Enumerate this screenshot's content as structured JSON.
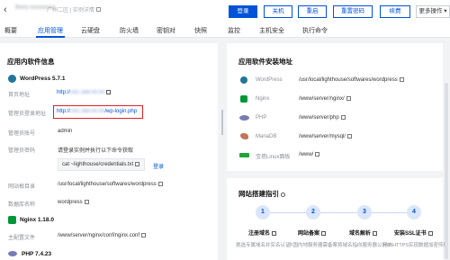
{
  "header": {
    "instance_id": "lhins-xxxxxxxx",
    "subtitle": "广州二区 | 实例详情",
    "buttons": {
      "login": "登录",
      "shutdown": "关机",
      "restart": "重启",
      "reset_password": "重置密码",
      "renew": "续费",
      "more": "更多操作"
    }
  },
  "tabs": [
    "概要",
    "应用管理",
    "云硬盘",
    "防火墙",
    "密钥对",
    "快照",
    "监控",
    "主机安全",
    "执行命令"
  ],
  "left_panel": {
    "title": "应用内软件信息",
    "wordpress": {
      "name": "WordPress 5.7.1",
      "home_label": "首页地址",
      "home_value": "http://",
      "admin_url_label": "管理员登录地址",
      "admin_url_prefix": "http://",
      "admin_url_suffix": "/wp-login.php",
      "admin_user_label": "管理员账号",
      "admin_user_value": "admin",
      "admin_pass_label": "管理员密码",
      "admin_pass_hint": "请登录实例并执行以下命令获取",
      "admin_pass_cmd": "cat ~lighthouse/credentials.txt",
      "login_link": "登录",
      "root_label": "网站根目录",
      "root_value": "/usr/local/lighthouse/softwares/wordpress",
      "db_label": "数据库名称",
      "db_value": "wordpress"
    },
    "nginx": {
      "name": "Nginx 1.18.0",
      "conf_label": "主配置文件",
      "conf_value": "/www/server/nginx/conf/nginx.conf"
    },
    "php": {
      "name": "PHP 7.4.23"
    }
  },
  "right_panel": {
    "title": "应用软件安装地址",
    "rows": [
      {
        "name": "WordPress",
        "path": "/usr/local/lighthouse/softwares/wordpress",
        "color": "#21759b"
      },
      {
        "name": "Nginx",
        "path": "/www/server/nginx/",
        "color": "#009639"
      },
      {
        "name": "PHP",
        "path": "/www/server/php",
        "color": "#777bb3"
      },
      {
        "name": "MariaDB",
        "path": "/www/server/mysql/",
        "color": "#c0765a"
      },
      {
        "name": "宝塔Linux面板",
        "path": "/www/",
        "color": "#20a53a"
      }
    ],
    "guide_title": "网站搭建指引",
    "steps": [
      {
        "n": "1",
        "title": "注册域名",
        "desc": "挑选专属域名并实名认证"
      },
      {
        "n": "2",
        "title": "网站备案",
        "desc": "中国内地服务器需备案"
      },
      {
        "n": "3",
        "title": "域名解析",
        "desc": "将域名指向服务器公网IP"
      },
      {
        "n": "4",
        "title": "安装SSL证书",
        "desc": "开启HTTPS实现数据加密传输"
      }
    ]
  }
}
